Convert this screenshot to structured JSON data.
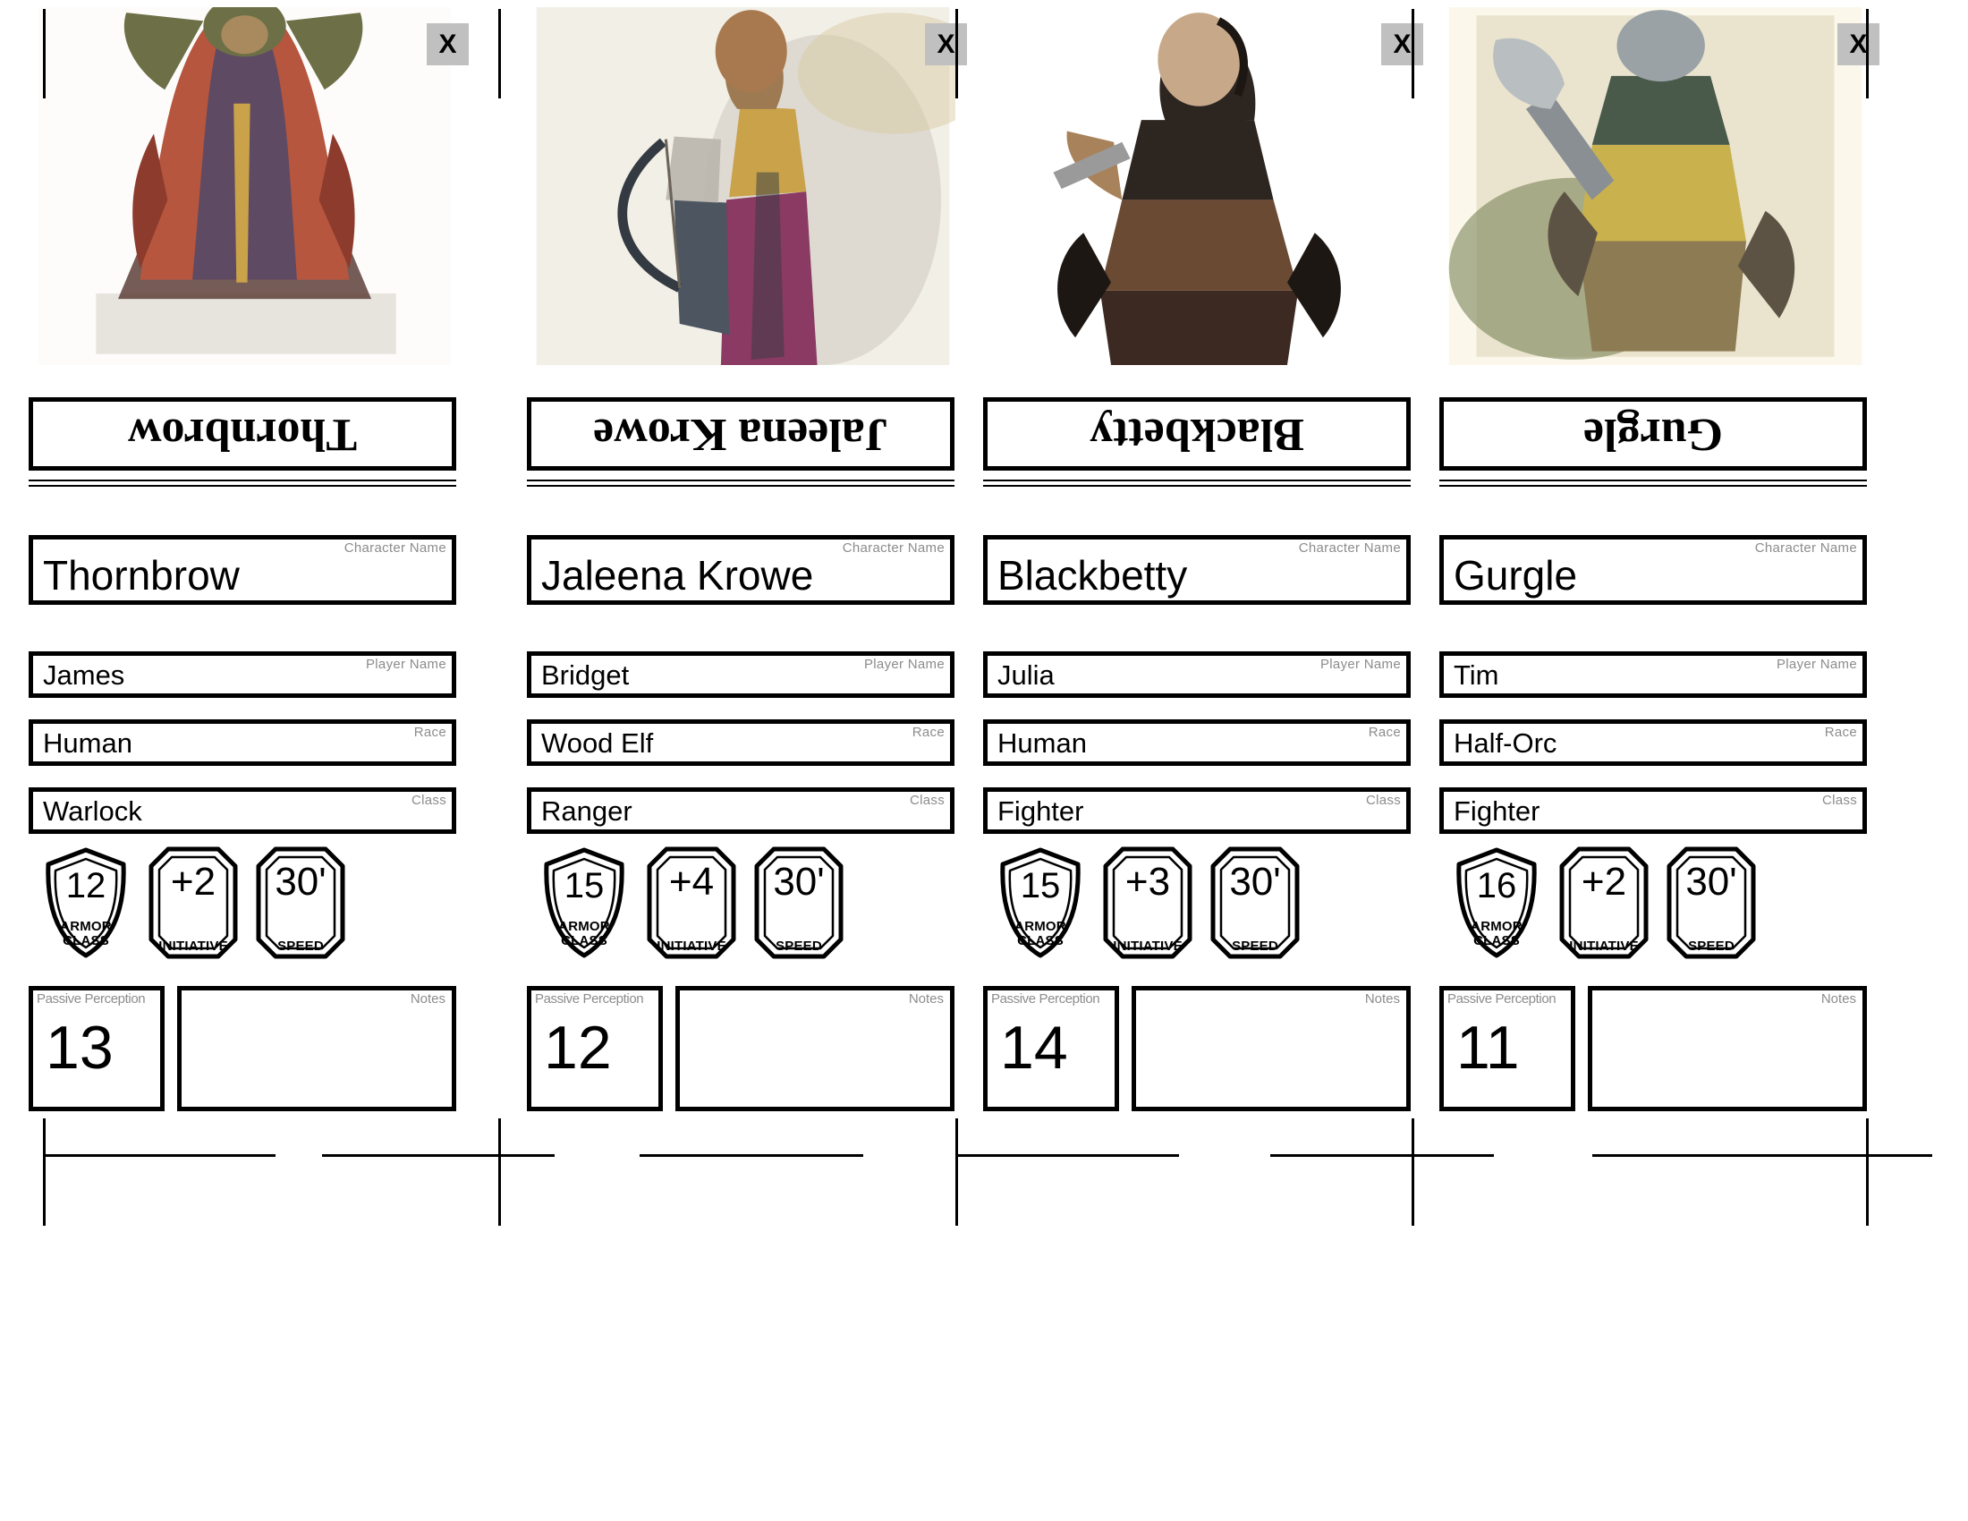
{
  "labels": {
    "character_name": "Character Name",
    "player_name": "Player Name",
    "race": "Race",
    "class": "Class",
    "passive_perception": "Passive Perception",
    "notes": "Notes",
    "armor_class_line1": "ARMOR",
    "armor_class_line2": "CLASS",
    "initiative": "INITIATIVE",
    "speed": "SPEED",
    "close": "X"
  },
  "colors": {
    "ink": "#000000",
    "label_gray": "#8c8c8c",
    "close_button_bg": "#c0c0c0",
    "page_bg": "#ffffff"
  },
  "cards": [
    {
      "banner_name": "Thornbrow",
      "character_name": "Thornbrow",
      "player_name": "James",
      "race": "Human",
      "class": "Warlock",
      "armor_class": "12",
      "initiative": "+2",
      "speed": "30'",
      "passive_perception": "13",
      "notes": "",
      "art": {
        "alt": "warlock-portrait",
        "bg": "#fdfcfb",
        "tones": [
          "#b6563f",
          "#8d3b2c",
          "#5d4038",
          "#6d7046",
          "#c9a24a",
          "#d6cfc6",
          "#5e4a63"
        ]
      }
    },
    {
      "banner_name": "Jaleena Krowe",
      "character_name": "Jaleena Krowe",
      "player_name": "Bridget",
      "race": "Wood Elf",
      "class": "Ranger",
      "armor_class": "15",
      "initiative": "+4",
      "speed": "30'",
      "passive_perception": "12",
      "notes": "",
      "art": {
        "alt": "ranger-portrait",
        "bg": "#f2efe7",
        "tones": [
          "#8a3a63",
          "#4c5560",
          "#c9a24a",
          "#9d7a52",
          "#b9b5ad",
          "#d8c79e",
          "#333a42"
        ]
      }
    },
    {
      "banner_name": "Blackbetty",
      "character_name": "Blackbetty",
      "player_name": "Julia",
      "race": "Human",
      "class": "Fighter",
      "armor_class": "15",
      "initiative": "+3",
      "speed": "30'",
      "passive_perception": "14",
      "notes": "",
      "art": {
        "alt": "fighter-portrait",
        "bg": "#ffffff",
        "tones": [
          "#3c2a22",
          "#6b4a33",
          "#a8825b",
          "#2d2520",
          "#c7a98a",
          "#8f6a48",
          "#1d1714"
        ]
      }
    },
    {
      "banner_name": "Gurgle",
      "character_name": "Gurgle",
      "player_name": "Tim",
      "race": "Half-Orc",
      "class": "Fighter",
      "armor_class": "16",
      "initiative": "+2",
      "speed": "30'",
      "passive_perception": "11",
      "notes": "",
      "art": {
        "alt": "half-orc-fighter-portrait",
        "bg": "#fbf7ea",
        "tones": [
          "#c9b24e",
          "#6e7a4a",
          "#4a5a4a",
          "#8d7b53",
          "#9aa2a6",
          "#5c5344",
          "#d9d2b4"
        ]
      }
    }
  ]
}
